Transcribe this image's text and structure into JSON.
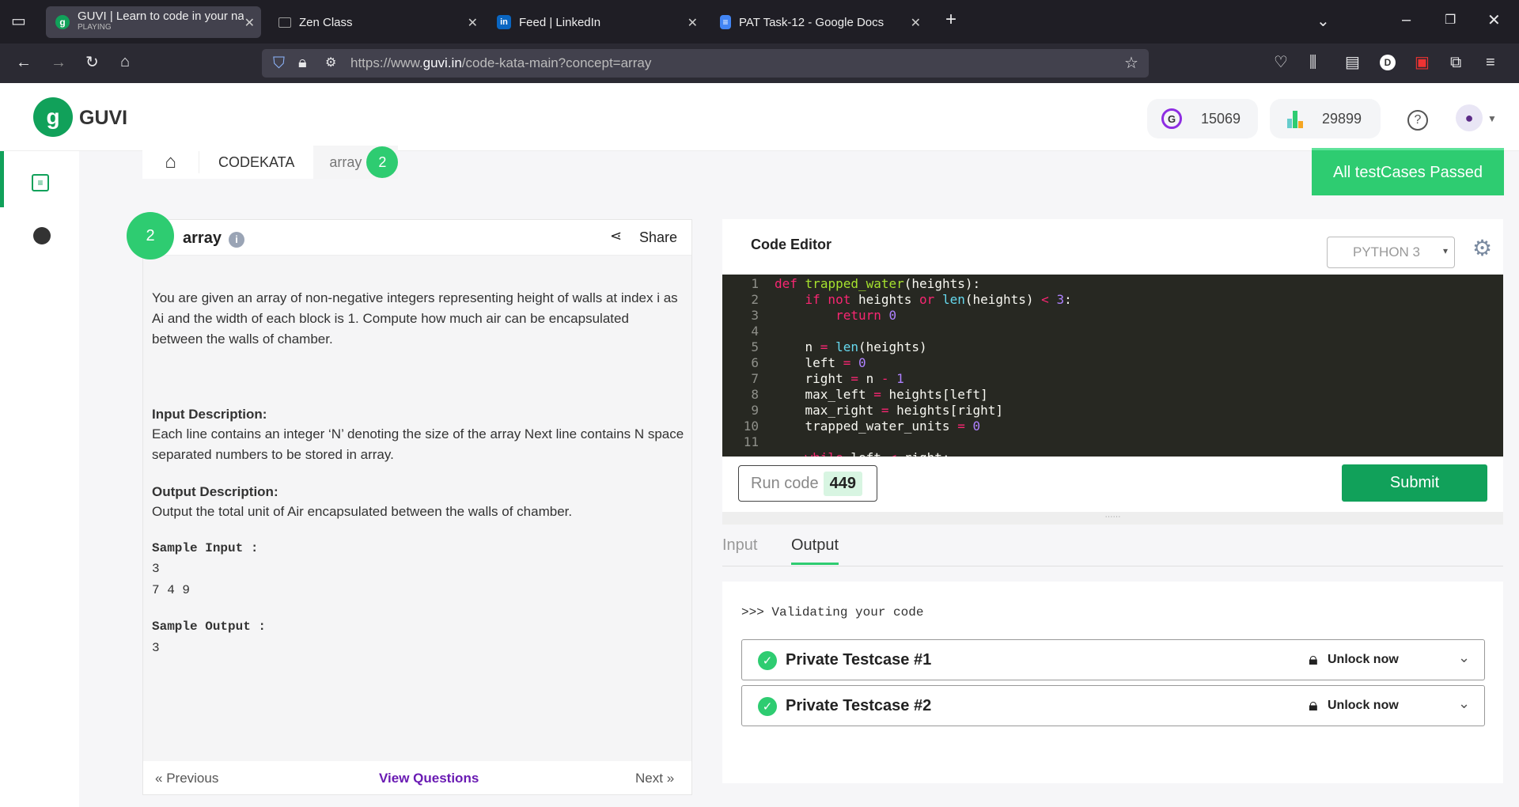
{
  "browser": {
    "tabs": [
      {
        "title": "GUVI | Learn to code in your nat",
        "sub": "PLAYING"
      },
      {
        "title": "Zen Class"
      },
      {
        "title": "Feed | LinkedIn"
      },
      {
        "title": "PAT Task-12 - Google Docs"
      }
    ],
    "url_prefix": "https://www.",
    "url_domain": "guvi.in",
    "url_path": "/code-kata-main?concept=array"
  },
  "header": {
    "logo": "GUVI",
    "geekoins": "15069",
    "rank": "29899"
  },
  "breadcrumb": {
    "root": "CODEKATA",
    "current": "array",
    "count": "2"
  },
  "toast": "All testCases Passed",
  "problem": {
    "number": "2",
    "title": "array",
    "share": "Share",
    "description": "You are given an array of non-negative integers representing height of walls at index i as Ai and the width of each block is 1. Compute how much air can be encapsulated between the walls of chamber.",
    "input_heading": "Input Description:",
    "input_text": "Each line contains an integer ‘N’ denoting the size of the array Next line contains N space separated numbers to be stored in array.",
    "output_heading": "Output Description:",
    "output_text": "Output the total unit of Air encapsulated between the walls of chamber.",
    "sample_input_label": "Sample Input :",
    "sample_input_l1": "3",
    "sample_input_l2": "7 4 9",
    "sample_output_label": "Sample Output :",
    "sample_output": "3",
    "prev": "Previous",
    "view": "View Questions",
    "next": "Next"
  },
  "editor": {
    "title": "Code Editor",
    "language": "PYTHON 3",
    "run_label": "Run code",
    "run_count": "449",
    "submit": "Submit",
    "lines": [
      "1",
      "2",
      "3",
      "4",
      "5",
      "6",
      "7",
      "8",
      "9",
      "10",
      "11"
    ]
  },
  "output": {
    "tab_input": "Input",
    "tab_output": "Output",
    "validating": ">>> Validating your code",
    "testcases": [
      {
        "name": "Private Testcase #1",
        "unlock": "Unlock now"
      },
      {
        "name": "Private Testcase #2",
        "unlock": "Unlock now"
      }
    ]
  },
  "colors": {
    "brand": "#11a15a",
    "success": "#2ecc71",
    "link": "#6a1bb3"
  }
}
